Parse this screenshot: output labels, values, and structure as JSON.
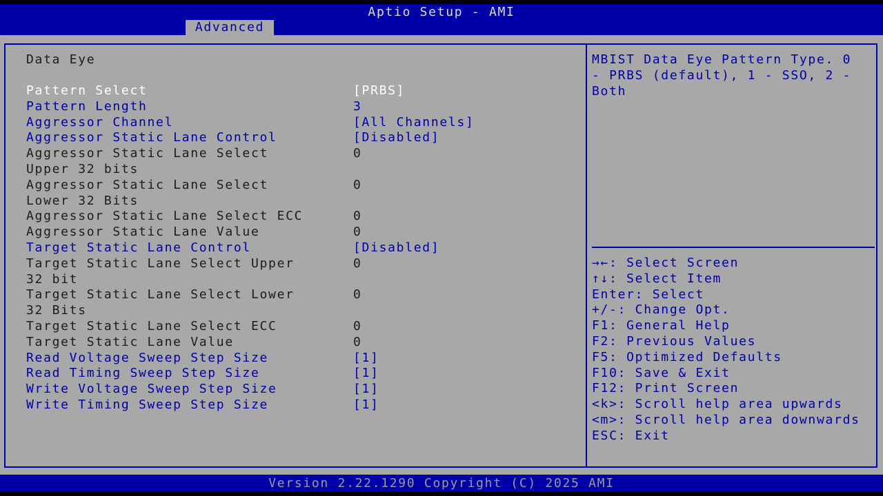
{
  "header": {
    "title": "Aptio Setup - AMI",
    "active_tab": "Advanced"
  },
  "section_title": "Data Eye",
  "settings": [
    {
      "label": "Pattern Select",
      "value": "[PRBS]",
      "style": "selected"
    },
    {
      "label": "Pattern Length",
      "value": "3",
      "style": "blue"
    },
    {
      "label": "Aggressor Channel",
      "value": "[All Channels]",
      "style": "blue"
    },
    {
      "label": "Aggressor Static Lane Control",
      "value": "[Disabled]",
      "style": "blue"
    },
    {
      "label": "Aggressor Static Lane Select\nUpper 32 bits",
      "value": "0",
      "style": "static"
    },
    {
      "label": "Aggressor Static Lane Select\nLower 32 Bits",
      "value": "0",
      "style": "static"
    },
    {
      "label": "Aggressor Static Lane Select ECC",
      "value": "0",
      "style": "static"
    },
    {
      "label": "Aggressor Static Lane Value",
      "value": "0",
      "style": "static"
    },
    {
      "label": "Target Static Lane Control",
      "value": "[Disabled]",
      "style": "blue"
    },
    {
      "label": "Target Static Lane Select Upper\n32 bit",
      "value": "0",
      "style": "static"
    },
    {
      "label": "Target Static Lane Select Lower\n32 Bits",
      "value": "0",
      "style": "static"
    },
    {
      "label": "Target Static Lane Select ECC",
      "value": "0",
      "style": "static"
    },
    {
      "label": "Target Static Lane Value",
      "value": "0",
      "style": "static"
    },
    {
      "label": "Read Voltage Sweep Step Size",
      "value": "[1]",
      "style": "blue"
    },
    {
      "label": "Read Timing Sweep Step Size",
      "value": "[1]",
      "style": "blue"
    },
    {
      "label": "Write Voltage Sweep Step Size",
      "value": "[1]",
      "style": "blue"
    },
    {
      "label": "Write Timing Sweep Step Size",
      "value": "[1]",
      "style": "blue"
    }
  ],
  "help": {
    "text": "MBIST Data Eye Pattern Type. 0\n- PRBS (default), 1 - SSO, 2 -\nBoth"
  },
  "keys": [
    "→←: Select Screen",
    "↑↓: Select Item",
    "Enter: Select",
    "+/-: Change Opt.",
    "F1: General Help",
    "F2: Previous Values",
    "F5: Optimized Defaults",
    "F10: Save & Exit",
    "F12: Print Screen",
    "<k>: Scroll help area upwards",
    "<m>: Scroll help area downwards",
    "ESC: Exit"
  ],
  "footer": {
    "text": "Version 2.22.1290 Copyright (C) 2025 AMI"
  },
  "colors": {
    "bar_blue": "#0000a8",
    "panel_gray": "#a8a8a8",
    "selected_text": "#ffffff",
    "static_text": "#1c1c1c"
  }
}
